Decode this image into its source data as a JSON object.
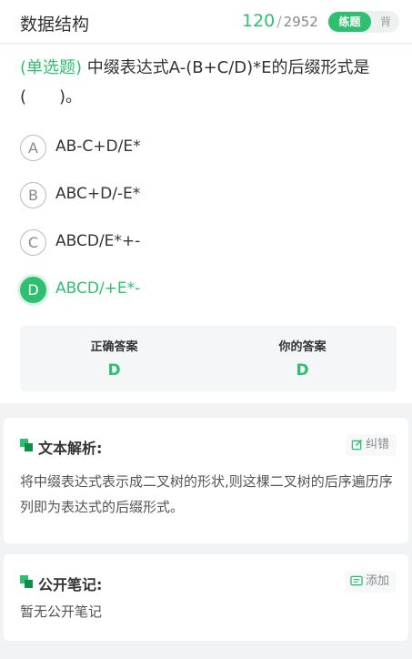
{
  "header": {
    "title": "数据结构",
    "progress_current": "120",
    "progress_separator": "/",
    "progress_total": "2952",
    "mode_practice": "练题",
    "mode_memorize": "背"
  },
  "question": {
    "type_label": "(单选题)",
    "text": "中缀表达式A-(B+C/D)*E的后缀形式是(　　)。",
    "options": [
      {
        "letter": "A",
        "text": "AB-C+D/E*"
      },
      {
        "letter": "B",
        "text": "ABC+D/-E*"
      },
      {
        "letter": "C",
        "text": "ABCD/E*+-"
      },
      {
        "letter": "D",
        "text": "ABCD/+E*-"
      }
    ],
    "correct_label": "正确答案",
    "correct_value": "D",
    "your_label": "你的答案",
    "your_value": "D"
  },
  "analysis": {
    "title": "文本解析:",
    "button": "纠错",
    "text": "将中缀表达式表示成二叉树的形状,则这棵二叉树的后序遍历序列即为表达式的后缀形式。"
  },
  "notes": {
    "title": "公开笔记:",
    "button": "添加",
    "empty": "暂无公开笔记"
  },
  "colors": {
    "accent": "#2fbf71"
  }
}
